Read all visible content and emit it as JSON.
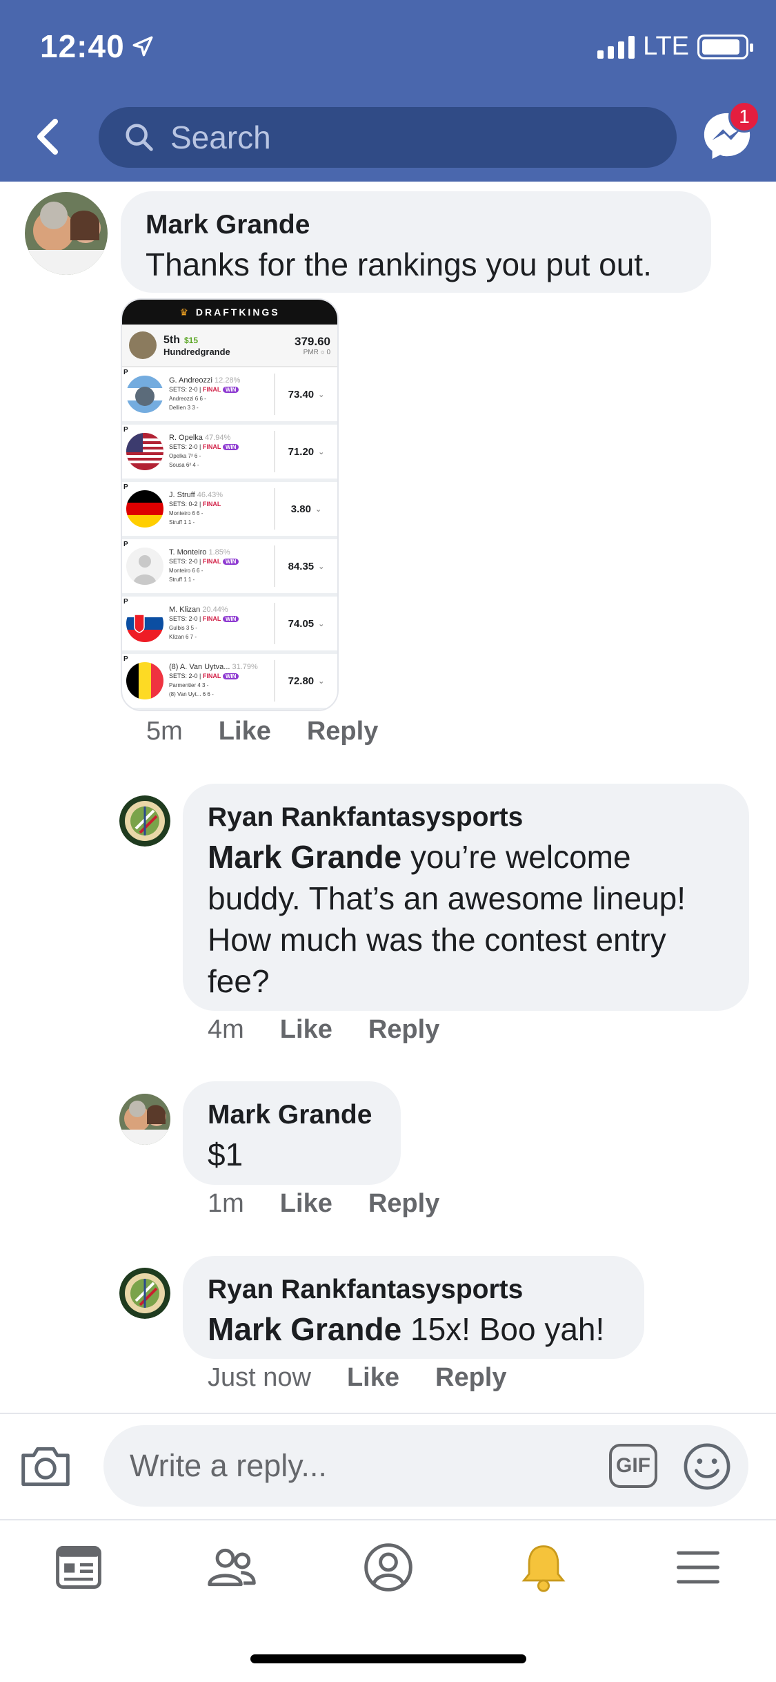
{
  "status": {
    "time": "12:40",
    "network": "LTE"
  },
  "header": {
    "search_placeholder": "Search",
    "messenger_badge": "1"
  },
  "post": {
    "author": "Mark Grande",
    "text": "Thanks for the rankings you put out.",
    "time": "5m",
    "like": "Like",
    "reply": "Reply"
  },
  "lineup": {
    "brand": "DRAFTKINGS",
    "rank": "5th",
    "winnings": "$15",
    "user": "Hundredgrande",
    "total": "379.60",
    "pmr": "PMR",
    "pmr_value": "0",
    "players": [
      {
        "pos": "P",
        "name": "G. Andreozzi",
        "pct": "12.28%",
        "sets": "SETS: 2-0",
        "final": "FINAL",
        "win": "WIN",
        "l1": "Andreozzi   6  6  -",
        "l2": "Dellien   3  3  -",
        "points": "73.40",
        "flag": "argentina"
      },
      {
        "pos": "P",
        "name": "R. Opelka",
        "pct": "47.94%",
        "sets": "SETS: 2-0",
        "final": "FINAL",
        "win": "WIN",
        "l1": "Opelka   7²  6  -",
        "l2": "Sousa   6²  4  -",
        "points": "71.20",
        "flag": "usa"
      },
      {
        "pos": "P",
        "name": "J. Struff",
        "pct": "46.43%",
        "sets": "SETS: 0-2",
        "final": "FINAL",
        "win": "",
        "l1": "Monteiro   6  6  -",
        "l2": "Struff   1  1  -",
        "points": "3.80",
        "flag": "germany"
      },
      {
        "pos": "P",
        "name": "T. Monteiro",
        "pct": "1.85%",
        "sets": "SETS: 2-0",
        "final": "FINAL",
        "win": "WIN",
        "l1": "Monteiro   6  6  -",
        "l2": "Struff   1  1  -",
        "points": "84.35",
        "flag": "none"
      },
      {
        "pos": "P",
        "name": "M. Klizan",
        "pct": "20.44%",
        "sets": "SETS: 2-0",
        "final": "FINAL",
        "win": "WIN",
        "l1": "Gulbis   3  5  -",
        "l2": "Klizan   6  7  -",
        "points": "74.05",
        "flag": "slovakia"
      },
      {
        "pos": "P",
        "name": "(8) A. Van Uytva...",
        "pct": "31.79%",
        "sets": "SETS: 2-0",
        "final": "FINAL",
        "win": "WIN",
        "l1": "Parmentier   4  3  -",
        "l2": "(8) Van Uyt...   6  6  -",
        "points": "72.80",
        "flag": "belgium"
      }
    ]
  },
  "replies": [
    {
      "author": "Ryan Rankfantasysports",
      "mention": "Mark Grande",
      "text": " you’re welcome buddy.  That’s an awesome lineup! How much was the contest entry fee?",
      "time": "4m",
      "like": "Like",
      "reply": "Reply"
    },
    {
      "author": "Mark Grande",
      "mention": "",
      "text": "$1",
      "time": "1m",
      "like": "Like",
      "reply": "Reply"
    },
    {
      "author": "Ryan Rankfantasysports",
      "mention": "Mark Grande",
      "text": " 15x! Boo yah!",
      "time": "Just now",
      "like": "Like",
      "reply": "Reply"
    }
  ],
  "composer": {
    "placeholder": "Write a reply...",
    "gif": "GIF"
  },
  "tabs": [
    "news-feed-icon",
    "groups-icon",
    "profile-icon",
    "notifications-icon",
    "menu-icon"
  ],
  "colors": {
    "header": "#4a67ad",
    "search": "#304b86",
    "bubble": "#f0f2f5",
    "notify": "#f5c33b",
    "badge": "#e41e3f"
  }
}
